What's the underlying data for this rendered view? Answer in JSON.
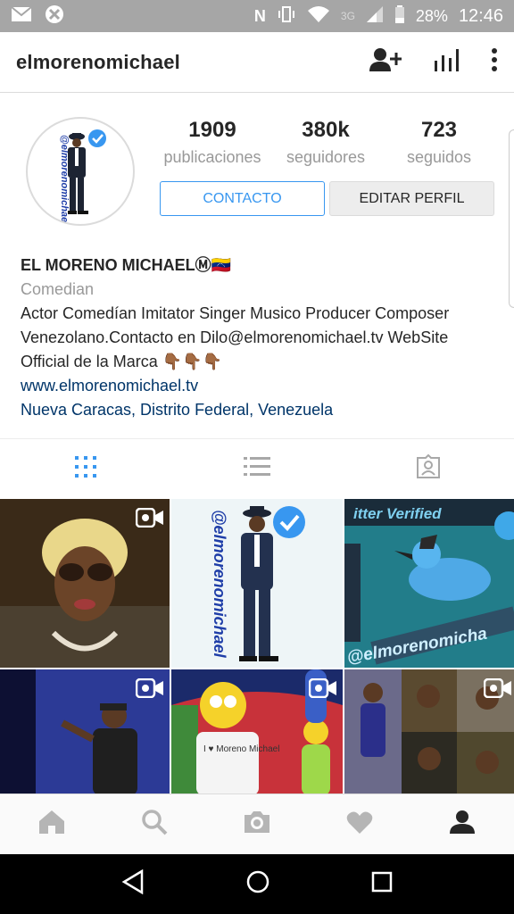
{
  "statusbar": {
    "battery": "28%",
    "time": "12:46",
    "network": "3G"
  },
  "header": {
    "username": "elmorenomichael",
    "icons": [
      "add-person-icon",
      "insights-icon",
      "more-vertical-icon"
    ]
  },
  "profile": {
    "avatar_text": "@elmorenomichael",
    "stats": [
      {
        "value": "1909",
        "label": "publicaciones"
      },
      {
        "value": "380k",
        "label": "seguidores"
      },
      {
        "value": "723",
        "label": "seguidos"
      }
    ],
    "contact_label": "CONTACTO",
    "edit_label": "EDITAR PERFIL"
  },
  "bio": {
    "name": "EL MORENO MICHAELⓂ🇻🇪",
    "category": "Comedian",
    "line1": "Actor Comedían Imitator Singer Musico Producer Composer",
    "line2": "Venezolano.Contacto en Dilo@elmorenomichael.tv WebSite",
    "line3": "Official de la Marca 👇🏾👇🏾👇🏾",
    "website": "www.elmorenomichael.tv",
    "location": "Nueva Caracas, Distrito Federal, Venezuela"
  },
  "tabs": [
    "grid-icon",
    "list-icon",
    "tagged-icon"
  ],
  "grid": {
    "tile2_text": "@elmorenomichael",
    "tile3_top": "itter Verified",
    "tile3_bottom": "@elmorenomicha",
    "tile5_text": "I ♥ Moreno Michael"
  },
  "colors": {
    "accent": "#3897f0",
    "link": "#003569",
    "muted": "#999999",
    "statusbar": "#a6a6a6"
  }
}
